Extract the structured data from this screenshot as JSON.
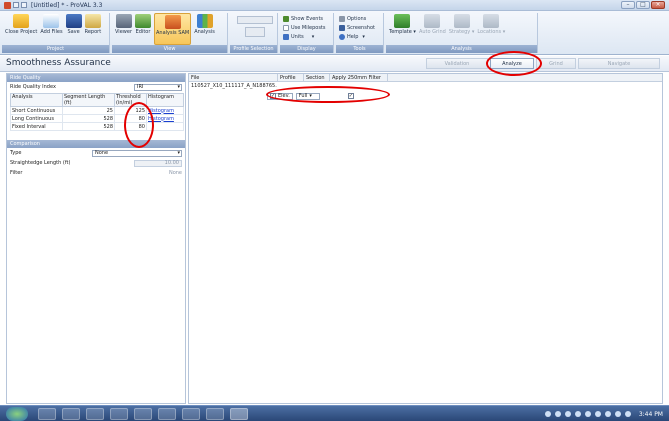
{
  "window": {
    "title": "[Untitled] * - ProVAL 3.3"
  },
  "ribbon": {
    "project": {
      "label": "Project",
      "buttons": [
        "Close Project",
        "Add Files",
        "Save",
        "Report"
      ]
    },
    "view": {
      "label": "View",
      "buttons": [
        "Viewer",
        "Editor",
        "Analysis SAM",
        "Analysis"
      ]
    },
    "profile_selection": {
      "label": "Profile Selection"
    },
    "display": {
      "label": "Display",
      "items": [
        "Show Events",
        "Use Mileposts",
        "Units"
      ]
    },
    "tools": {
      "label": "Tools",
      "items": [
        "Options",
        "Screenshot",
        "Help"
      ]
    },
    "analysis": {
      "label": "Analysis",
      "buttons": [
        "Template",
        "Auto Grind",
        "Strategy",
        "Locations"
      ]
    }
  },
  "page": {
    "title": "Smoothness Assurance",
    "steps": [
      "Validation",
      "Analyze",
      "Grind",
      "Navigate"
    ]
  },
  "ride_quality": {
    "section": "Ride Quality",
    "index_label": "Ride Quality Index",
    "index_value": "IRI",
    "columns": [
      "Analysis",
      "Segment Length (ft)",
      "Threshold (in/mi)",
      "Histogram"
    ],
    "rows": [
      {
        "analysis": "Short Continuous",
        "length": "25",
        "threshold": "125",
        "histogram": "Histogram"
      },
      {
        "analysis": "Long Continuous",
        "length": "528",
        "threshold": "80",
        "histogram": "Histogram"
      },
      {
        "analysis": "Fixed Interval",
        "length": "528",
        "threshold": "80",
        "histogram": ""
      }
    ]
  },
  "comparison": {
    "section": "Comparison",
    "type_label": "Type",
    "type_value": "None",
    "straightedge_label": "Straightedge Length (ft)",
    "straightedge_value": "10.00",
    "filter_label": "Filter",
    "filter_value": "None"
  },
  "files_table": {
    "columns": [
      "File",
      "Profile",
      "Section",
      "Apply 250mm Filter"
    ],
    "row": {
      "file": "110527_X10_111117_A_N188765.",
      "profile": "Elev.",
      "section": "Full"
    }
  },
  "taskbar": {
    "clock": "3:44 PM"
  }
}
